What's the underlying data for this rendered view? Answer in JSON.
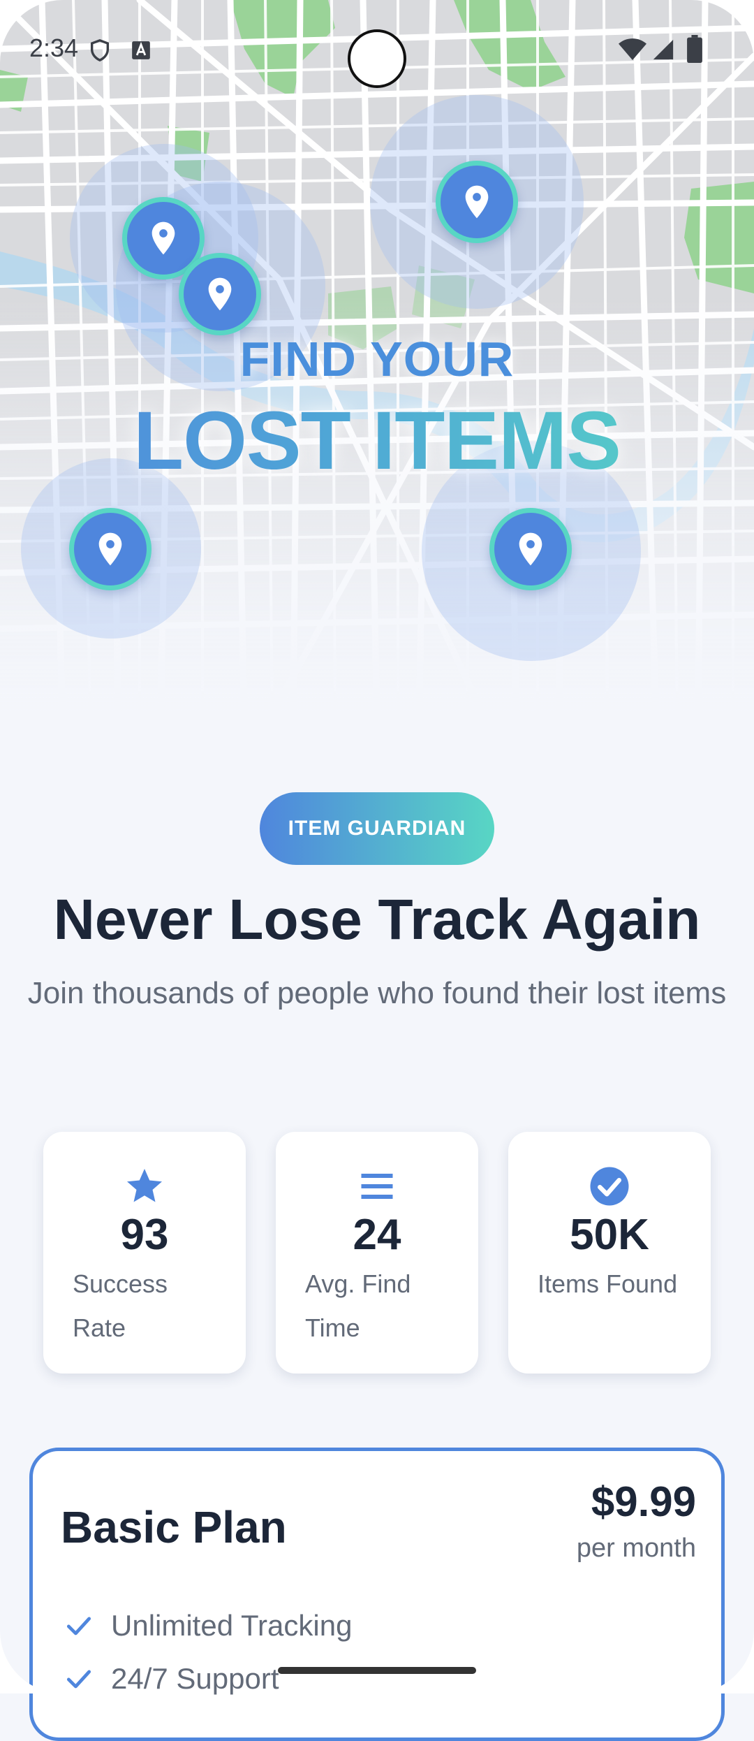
{
  "status_bar": {
    "time": "2:34"
  },
  "hero": {
    "title_line1": "FIND YOUR",
    "title_line2": "LOST ITEMS"
  },
  "badge": {
    "label": "ITEM GUARDIAN"
  },
  "headline": "Never Lose Track Again",
  "subtitle": "Join thousands of people who found their lost items",
  "stats": [
    {
      "icon": "star-icon",
      "value": "93",
      "label": "Success Rate"
    },
    {
      "icon": "menu-lines-icon",
      "value": "24",
      "label": "Avg. Find Time"
    },
    {
      "icon": "check-circle-icon",
      "value": "50K",
      "label": "Items Found"
    }
  ],
  "plan": {
    "name": "Basic Plan",
    "price": "$9.99",
    "period": "per month",
    "features": [
      "Unlimited Tracking",
      "24/7 Support"
    ]
  },
  "colors": {
    "brand_blue": "#4f86dd",
    "brand_teal": "#58d6c4",
    "text_dark": "#1c2638",
    "text_muted": "#626a78",
    "background": "#f4f6fb"
  }
}
